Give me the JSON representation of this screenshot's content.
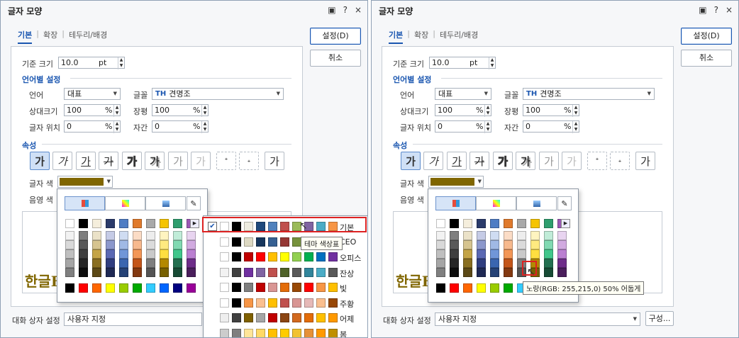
{
  "dialog": {
    "title": "글자 모양",
    "help_icon": "?",
    "close_icon": "×"
  },
  "tabs": [
    "기본",
    "확장",
    "테두리/배경"
  ],
  "buttons": {
    "ok": "설정(D)",
    "cancel": "취소",
    "config": "구성..."
  },
  "base_size": {
    "label": "기준 크기",
    "value": "10.0",
    "unit": "pt"
  },
  "lang_section": "언어별 설정",
  "lang": {
    "label": "언어",
    "value": "대표"
  },
  "font": {
    "label": "글꼴",
    "value": "견명조",
    "icon": "TH"
  },
  "rel_size": {
    "label": "상대크기",
    "value": "100",
    "unit": "%"
  },
  "ratio": {
    "label": "장평",
    "value": "100",
    "unit": "%"
  },
  "pos": {
    "label": "글자 위치",
    "value": "0",
    "unit": "%"
  },
  "spacing": {
    "label": "자간",
    "value": "0",
    "unit": "%"
  },
  "attr_section": "속성",
  "attr_glyph": "가",
  "text_color": {
    "label": "글자 색",
    "color": "#806600"
  },
  "shade_color": {
    "label": "음영 색"
  },
  "preview_text": "한글F",
  "dialog_setting": {
    "label": "대화 상자 설정",
    "value": "사용자 지정"
  },
  "themes": [
    {
      "label": "기본",
      "colors": [
        "#ffffff",
        "#000000",
        "#eeece1",
        "#1f497d",
        "#4f81bd",
        "#c0504d",
        "#9bbb59",
        "#8064a2",
        "#4bacc6",
        "#f79646"
      ]
    },
    {
      "label": "CEO",
      "colors": [
        "#ffffff",
        "#000000",
        "#ddd9c3",
        "#17365d",
        "#366092",
        "#953734",
        "#76923c",
        "#5f497a",
        "#31859b",
        "#e36c09"
      ]
    },
    {
      "label": "오피스",
      "colors": [
        "#ffffff",
        "#000000",
        "#c00000",
        "#ff0000",
        "#ffc000",
        "#ffff00",
        "#92d050",
        "#00b050",
        "#0070c0",
        "#7030a0"
      ]
    },
    {
      "label": "잔상",
      "colors": [
        "#f2f2f2",
        "#404040",
        "#7030a0",
        "#8064a2",
        "#c0504d",
        "#4f6228",
        "#595959",
        "#31859b",
        "#4bacc6",
        "#595959"
      ]
    },
    {
      "label": "빛",
      "colors": [
        "#ffffff",
        "#000000",
        "#7f7f7f",
        "#c00000",
        "#d99694",
        "#e36c09",
        "#984806",
        "#ff0000",
        "#f79646",
        "#ffc000"
      ]
    },
    {
      "label": "주황",
      "colors": [
        "#ffffff",
        "#000000",
        "#f79646",
        "#fac090",
        "#ffc000",
        "#c0504d",
        "#d99694",
        "#e6b9b8",
        "#fabf8f",
        "#984806"
      ]
    },
    {
      "label": "어제",
      "colors": [
        "#eeeeee",
        "#404040",
        "#7f6000",
        "#a5a5a5",
        "#c00000",
        "#8b4513",
        "#d2691e",
        "#e36c09",
        "#ffc000",
        "#ff9900"
      ]
    },
    {
      "label": "봄",
      "colors": [
        "#cccccc",
        "#7f7f7f",
        "#ffe599",
        "#ffd966",
        "#ffc000",
        "#ffcc00",
        "#f1c232",
        "#e69138",
        "#ff9900",
        "#bf9000"
      ]
    }
  ],
  "tooltips": {
    "theme": "테마 색상표",
    "color": "노랑(RGB: 255,215,0) 50% 어둡게"
  },
  "palette": {
    "top": [
      "#ffffff",
      "#000000",
      "#f5eedc",
      "#2b3b6b",
      "#4f7dc4",
      "#e07a2c",
      "#a9a9a9",
      "#f5c400",
      "#2e9e6e",
      "#9b59b6"
    ],
    "std": [
      "#000000",
      "#ff0000",
      "#ff6600",
      "#ffff00",
      "#99cc00",
      "#00aa00",
      "#33ccff",
      "#0066ff",
      "#000080",
      "#990099"
    ],
    "cols": [
      [
        "#f2f2f2",
        "#d9d9d9",
        "#bfbfbf",
        "#a6a6a6",
        "#7f7f7f"
      ],
      [
        "#7f7f7f",
        "#595959",
        "#3f3f3f",
        "#262626",
        "#0d0d0d"
      ],
      [
        "#ebe2c8",
        "#d6c48f",
        "#c4a446",
        "#8a6f21",
        "#5c4916"
      ],
      [
        "#c5cbe6",
        "#8c98cc",
        "#5a68b3",
        "#303e80",
        "#1f2954"
      ],
      [
        "#cfdcf2",
        "#a0b9e5",
        "#7096d8",
        "#3a66b0",
        "#254276"
      ],
      [
        "#fbdcc6",
        "#f7b98e",
        "#f39656",
        "#c4561a",
        "#833911"
      ],
      [
        "#ededed",
        "#dbdbdb",
        "#c9c9c9",
        "#7f7f7f",
        "#545454"
      ],
      [
        "#fff4c0",
        "#ffea80",
        "#ffdf40",
        "#b38900",
        "#776000"
      ],
      [
        "#c0ecd8",
        "#80d9b2",
        "#40c68b",
        "#237050",
        "#174b35"
      ],
      [
        "#e8d4f0",
        "#d1aae0",
        "#ba7fd1",
        "#6e2d8a",
        "#4a1e5c"
      ]
    ]
  }
}
